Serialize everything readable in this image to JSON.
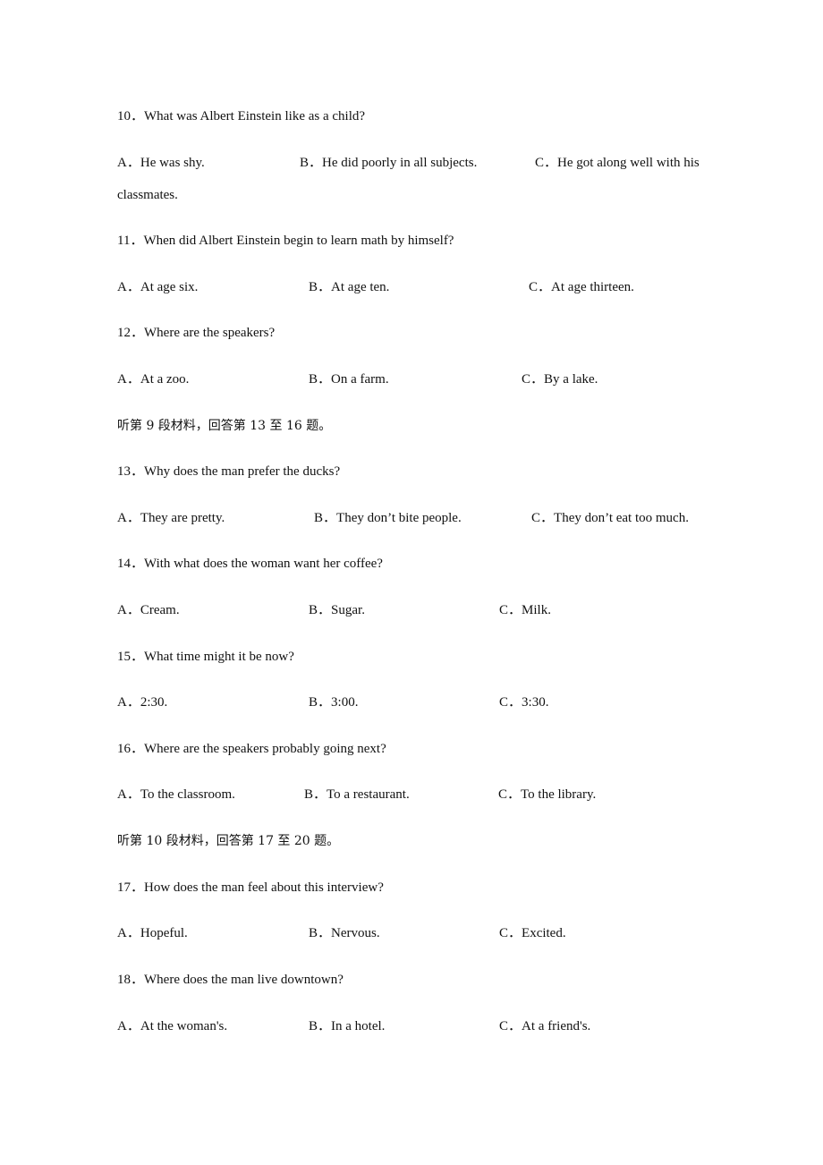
{
  "document": {
    "items": [
      {
        "type": "question",
        "number": "10",
        "text": "What was Albert Einstein like as a child?",
        "options": [
          {
            "letter": "A",
            "text": "He was shy."
          },
          {
            "letter": "B",
            "text": "He did poorly in all subjects."
          },
          {
            "letter": "C",
            "text": "He got along well with his"
          }
        ],
        "option_wrap": "classmates."
      },
      {
        "type": "question",
        "number": "11",
        "text": "When did Albert Einstein begin to learn math by himself?",
        "options": [
          {
            "letter": "A",
            "text": "At age six."
          },
          {
            "letter": "B",
            "text": "At age ten."
          },
          {
            "letter": "C",
            "text": "At age thirteen."
          }
        ]
      },
      {
        "type": "question",
        "number": "12",
        "text": "Where are the speakers?",
        "options": [
          {
            "letter": "A",
            "text": "At a zoo."
          },
          {
            "letter": "B",
            "text": "On a farm."
          },
          {
            "letter": "C",
            "text": "By a lake."
          }
        ]
      },
      {
        "type": "instruction",
        "text": "听第 9 段材料，回答第 13 至 16 题。"
      },
      {
        "type": "question",
        "number": "13",
        "text": "Why does the man prefer the ducks?",
        "options": [
          {
            "letter": "A",
            "text": "They are pretty."
          },
          {
            "letter": "B",
            "text": "They don’t bite people."
          },
          {
            "letter": "C",
            "text": "They don’t eat too much."
          }
        ]
      },
      {
        "type": "question",
        "number": "14",
        "text": "With what does the woman want her coffee?",
        "options": [
          {
            "letter": "A",
            "text": "Cream."
          },
          {
            "letter": "B",
            "text": "Sugar."
          },
          {
            "letter": "C",
            "text": "Milk."
          }
        ]
      },
      {
        "type": "question",
        "number": "15",
        "text": "What time might it be now?",
        "options": [
          {
            "letter": "A",
            "text": "2:30."
          },
          {
            "letter": "B",
            "text": "3:00."
          },
          {
            "letter": "C",
            "text": "3:30."
          }
        ]
      },
      {
        "type": "question",
        "number": "16",
        "text": "Where are the speakers probably going next?",
        "options": [
          {
            "letter": "A",
            "text": "To the classroom."
          },
          {
            "letter": "B",
            "text": "To a restaurant."
          },
          {
            "letter": "C",
            "text": "To the library."
          }
        ]
      },
      {
        "type": "instruction",
        "text": "听第 10 段材料，回答第 17 至 20 题。"
      },
      {
        "type": "question",
        "number": "17",
        "text": "How does the man feel about this interview?",
        "options": [
          {
            "letter": "A",
            "text": "Hopeful."
          },
          {
            "letter": "B",
            "text": "Nervous."
          },
          {
            "letter": "C",
            "text": "Excited."
          }
        ]
      },
      {
        "type": "question",
        "number": "18",
        "text": "Where does the man live downtown?",
        "options": [
          {
            "letter": "A",
            "text": "At the woman's."
          },
          {
            "letter": "B",
            "text": "In a hotel."
          },
          {
            "letter": "C",
            "text": "At a friend's."
          }
        ]
      }
    ],
    "separator": "．"
  }
}
